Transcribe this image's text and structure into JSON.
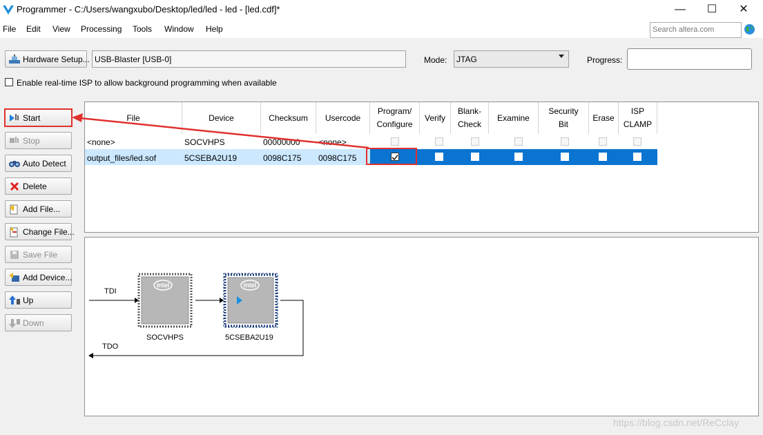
{
  "window": {
    "title": "Programmer - C:/Users/wangxubo/Desktop/led/led - led - [led.cdf]*",
    "minimize": "—",
    "maximize": "☐",
    "close": "✕"
  },
  "menu": [
    "File",
    "Edit",
    "View",
    "Processing",
    "Tools",
    "Window",
    "Help"
  ],
  "search": {
    "placeholder": "Search altera.com"
  },
  "toolbar": {
    "hardware_setup_label": "Hardware Setup...",
    "hardware_value": "USB-Blaster [USB-0]",
    "mode_label": "Mode:",
    "mode_value": "JTAG",
    "progress_label": "Progress:",
    "progress_value": 0,
    "isp_label": "Enable real-time ISP to allow background programming when available",
    "isp_checked": false
  },
  "side_buttons": [
    {
      "label": "Start",
      "enabled": true,
      "icon": "start-icon"
    },
    {
      "label": "Stop",
      "enabled": false,
      "icon": "stop-icon"
    },
    {
      "label": "Auto Detect",
      "enabled": true,
      "icon": "auto-detect-icon"
    },
    {
      "label": "Delete",
      "enabled": true,
      "icon": "delete-icon"
    },
    {
      "label": "Add File...",
      "enabled": true,
      "icon": "add-file-icon"
    },
    {
      "label": "Change File...",
      "enabled": true,
      "icon": "change-file-icon"
    },
    {
      "label": "Save File",
      "enabled": false,
      "icon": "save-file-icon"
    },
    {
      "label": "Add Device...",
      "enabled": true,
      "icon": "add-device-icon"
    },
    {
      "label": "Up",
      "enabled": true,
      "icon": "up-icon"
    },
    {
      "label": "Down",
      "enabled": false,
      "icon": "down-icon"
    }
  ],
  "table": {
    "columns": [
      {
        "line1": "File",
        "line2": ""
      },
      {
        "line1": "Device",
        "line2": ""
      },
      {
        "line1": "Checksum",
        "line2": ""
      },
      {
        "line1": "Usercode",
        "line2": ""
      },
      {
        "line1": "Program/",
        "line2": "Configure"
      },
      {
        "line1": "Verify",
        "line2": ""
      },
      {
        "line1": "Blank-",
        "line2": "Check"
      },
      {
        "line1": "Examine",
        "line2": ""
      },
      {
        "line1": "Security",
        "line2": "Bit"
      },
      {
        "line1": "Erase",
        "line2": ""
      },
      {
        "line1": "ISP",
        "line2": "CLAMP"
      }
    ],
    "rows": [
      {
        "file": "<none>",
        "device": "SOCVHPS",
        "checksum": "00000000",
        "usercode": "<none>",
        "options": [
          false,
          false,
          false,
          false,
          false,
          false,
          false
        ],
        "selected": false
      },
      {
        "file": "output_files/led.sof",
        "device": "5CSEBA2U19",
        "checksum": "0098C175",
        "usercode": "0098C175",
        "options": [
          true,
          false,
          false,
          false,
          false,
          false,
          false
        ],
        "selected": true
      }
    ]
  },
  "chain": {
    "tdi_label": "TDI",
    "tdo_label": "TDO",
    "devices": [
      {
        "name": "SOCVHPS",
        "logo": "intel",
        "selected": false
      },
      {
        "name": "5CSEBA2U19",
        "logo": "intel",
        "selected": true
      }
    ]
  },
  "watermark": "https://blog.csdn.net/ReCclay",
  "colors": {
    "selection_blue": "#0a74d0",
    "selection_light": "#cce8ff",
    "annotation_red": "#e0302e"
  }
}
